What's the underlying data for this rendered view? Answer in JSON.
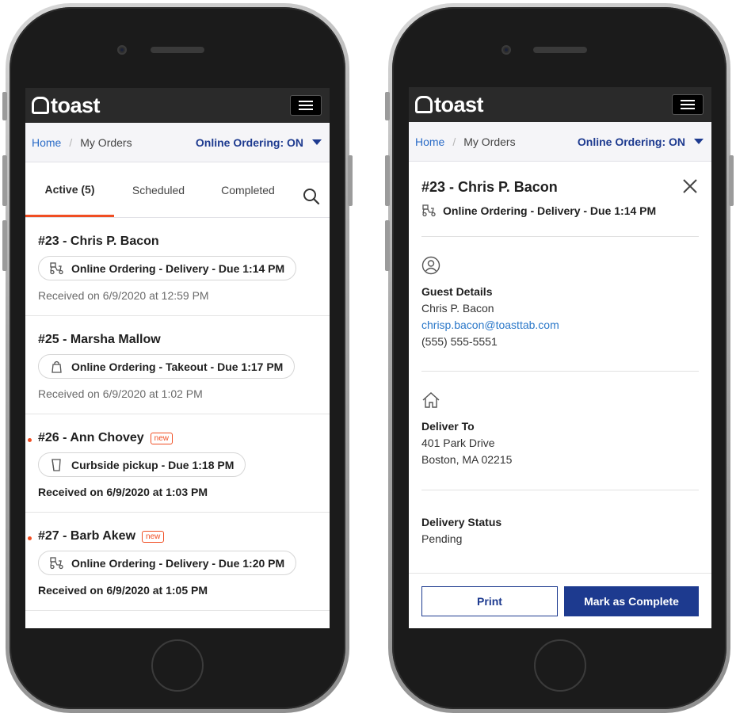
{
  "brand": {
    "name": "toast"
  },
  "breadcrumb": {
    "home": "Home",
    "current": "My Orders",
    "separator": "/"
  },
  "online_ordering": {
    "label": "Online Ordering: ON"
  },
  "tabs": [
    {
      "label": "Active (5)",
      "active": true
    },
    {
      "label": "Scheduled",
      "active": false
    },
    {
      "label": "Completed",
      "active": false
    }
  ],
  "orders": [
    {
      "title": "#23 - Chris P. Bacon",
      "type": "Online Ordering - Delivery - Due 1:14 PM",
      "icon": "delivery-scooter-icon",
      "received": "Received on 6/9/2020 at 12:59 PM",
      "new": false
    },
    {
      "title": "#25 - Marsha Mallow",
      "type": "Online Ordering - Takeout - Due 1:17 PM",
      "icon": "takeout-bag-icon",
      "received": "Received on 6/9/2020 at 1:02 PM",
      "new": false
    },
    {
      "title": "#26 - Ann Chovey",
      "type": "Curbside pickup - Due 1:18 PM",
      "icon": "curbside-icon",
      "received": "Received on 6/9/2020 at 1:03 PM",
      "new": true
    },
    {
      "title": "#27 - Barb Akew",
      "type": "Online Ordering - Delivery - Due 1:20 PM",
      "icon": "delivery-scooter-icon",
      "received": "Received on 6/9/2020 at 1:05 PM",
      "new": true
    }
  ],
  "badge_new": "new",
  "detail": {
    "title": "#23 - Chris P. Bacon",
    "subtitle": "Online Ordering - Delivery - Due 1:14 PM",
    "guest": {
      "label": "Guest Details",
      "name": "Chris P. Bacon",
      "email": "chrisp.bacon@toasttab.com",
      "phone": "(555) 555-5551"
    },
    "deliver_to": {
      "label": "Deliver To",
      "line1": "401 Park Drive",
      "line2": "Boston, MA 02215"
    },
    "delivery_status": {
      "label": "Delivery Status",
      "value": "Pending"
    },
    "print_label": "Print",
    "complete_label": "Mark as Complete"
  },
  "colors": {
    "accent": "#f04e23",
    "primary": "#1d3a8f",
    "link": "#2b6cc7",
    "header": "#2a2a2a"
  }
}
